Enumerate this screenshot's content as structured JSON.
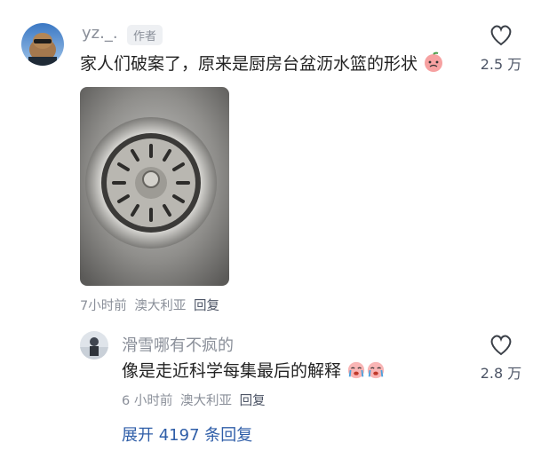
{
  "comments": [
    {
      "username": "yz._.",
      "author_tag": "作者",
      "text": "家人们破案了，原来是厨房台盆沥水篮的形状",
      "emoji": "peach-face-emoji",
      "time": "7小时前",
      "location": "澳大利亚",
      "reply_label": "回复",
      "likes": "2.5 万"
    }
  ],
  "replies": [
    {
      "username": "滑雪哪有不疯的",
      "text": "像是走近科学每集最后的解释",
      "emojis": [
        "crying-face-emoji",
        "crying-face-emoji"
      ],
      "time": "6 小时前",
      "location": "澳大利亚",
      "reply_label": "回复",
      "likes": "2.8 万"
    }
  ],
  "expand_replies": "展开 4197 条回复",
  "colors": {
    "meta_gray": "#8a8f99",
    "link_blue": "#2f5ea8"
  }
}
